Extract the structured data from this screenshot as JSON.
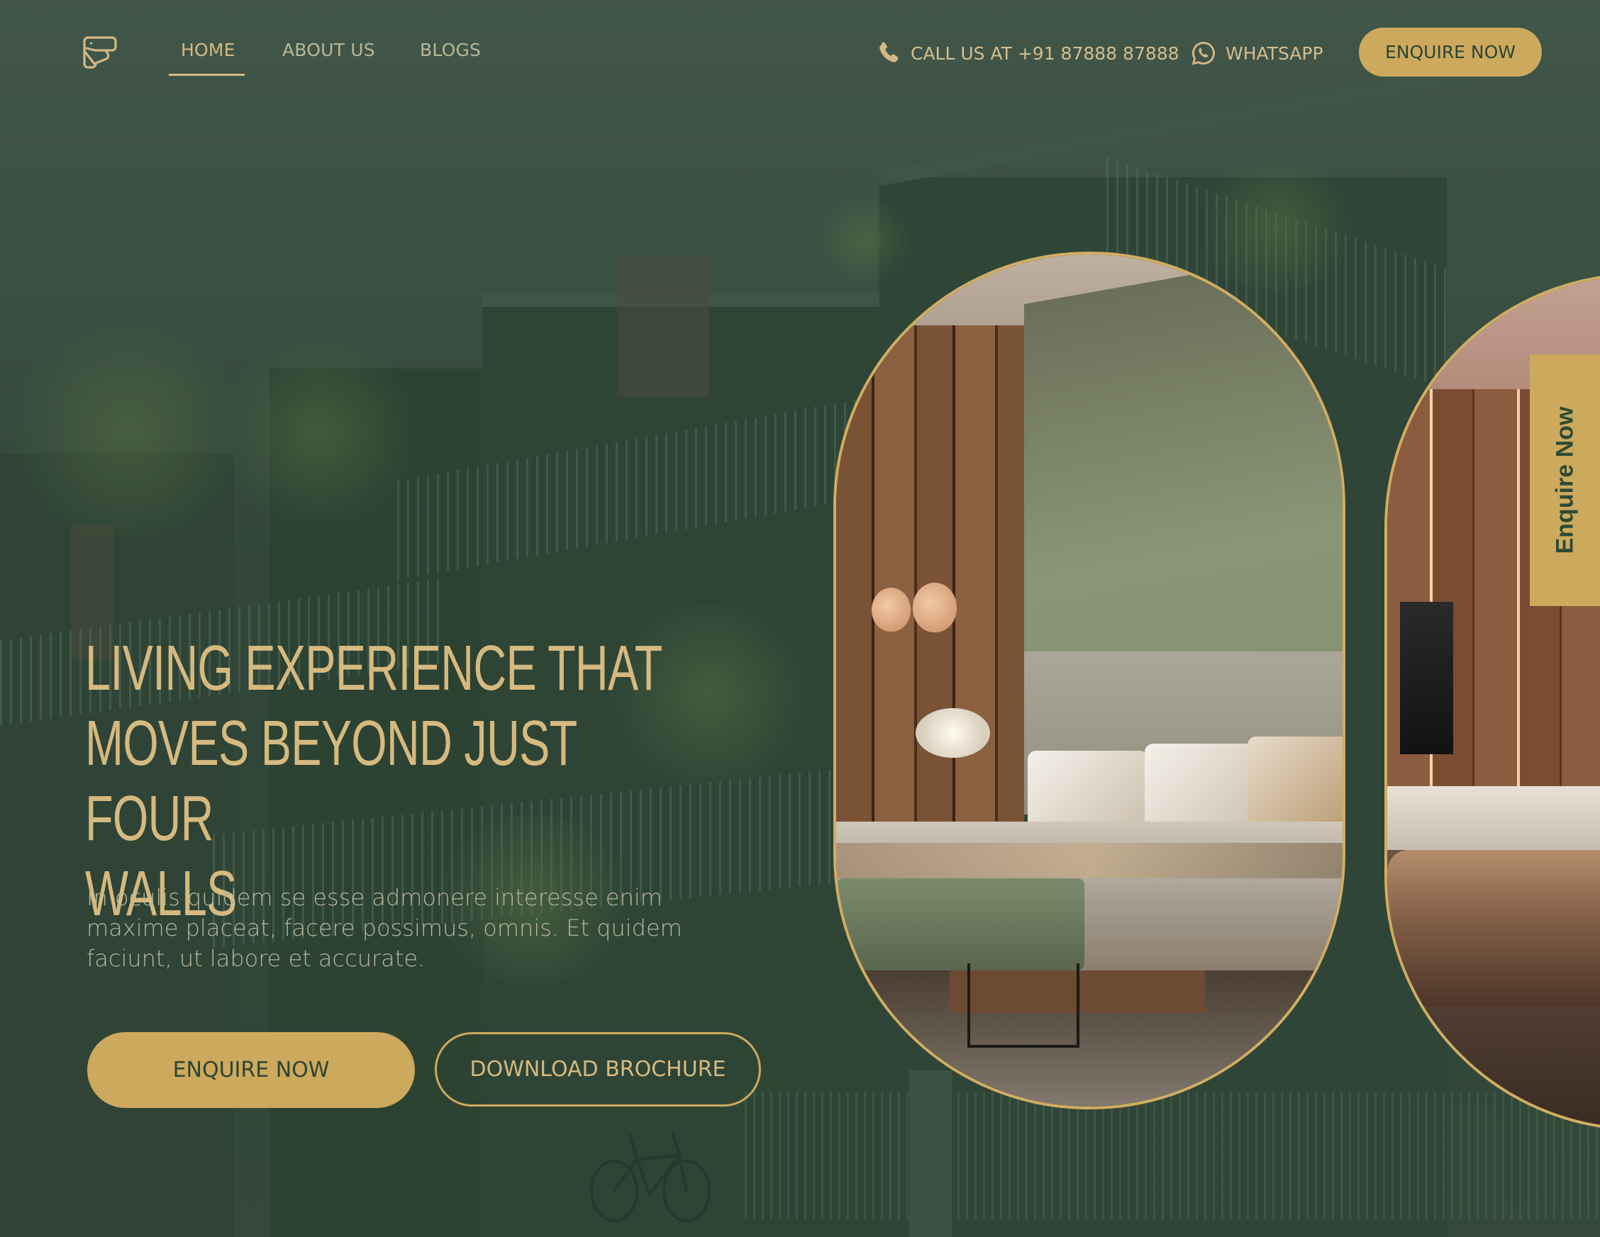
{
  "header": {
    "logo_icon": "brand-logo-icon",
    "nav": [
      {
        "label": "HOME",
        "active": true
      },
      {
        "label": "ABOUT US",
        "active": false
      },
      {
        "label": "BLOGS",
        "active": false
      }
    ],
    "call": {
      "icon": "phone-icon",
      "label": "CALL US AT +91 87888 87888"
    },
    "whatsapp": {
      "icon": "whatsapp-icon",
      "label": "WHATSAPP"
    },
    "enquire_label": "ENQUIRE NOW"
  },
  "hero": {
    "title": "LIVING EXPERIENCE THAT MOVES BEYOND JUST FOUR WALLS",
    "title_lines": [
      "LIVING EXPERIENCE THAT",
      "MOVES BEYOND JUST FOUR",
      "WALLS"
    ],
    "description": "In oculis quidem se esse admonere interesse enim maxime placeat, facere possimus, omnis. Et quidem faciunt, ut labore et accurate.",
    "primary_button": "ENQUIRE NOW",
    "secondary_button": "DOWNLOAD BROCHURE"
  },
  "gallery": [
    {
      "scene": "bedroom"
    },
    {
      "scene": "living-room"
    }
  ],
  "side_tab": {
    "label": "Enquire Now"
  },
  "colors": {
    "brand_gold": "#cca95d",
    "heading_gold": "#d6b97f",
    "dark_green": "#2d4433",
    "background_green": "#3a4f43",
    "muted_text": "#b8b79b"
  }
}
